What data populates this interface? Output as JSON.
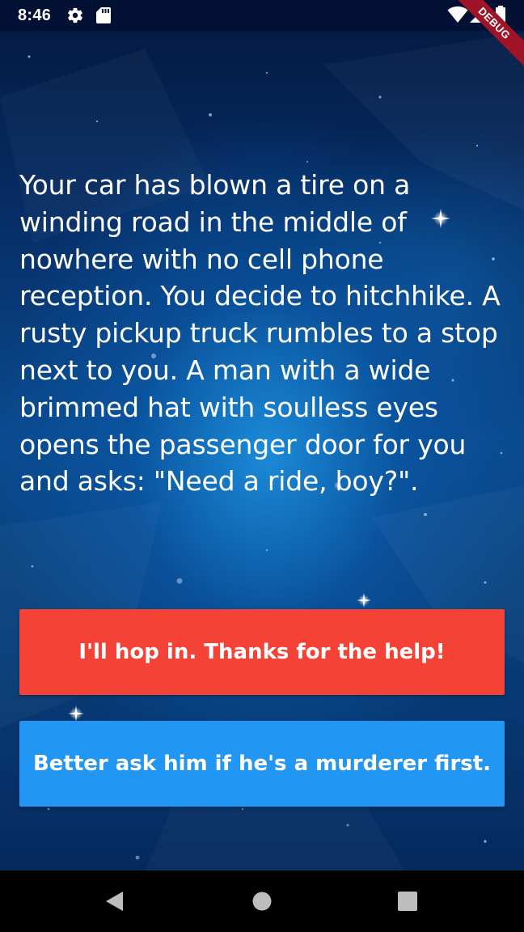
{
  "status_bar": {
    "time": "8:46",
    "icons": [
      "gear-icon",
      "sd-card-icon",
      "wifi-icon",
      "signal-icon",
      "battery-icon"
    ]
  },
  "debug_banner": {
    "label": "DEBUG",
    "color": "#a01428"
  },
  "story": {
    "text": "Your car has blown a tire on a winding road in the middle of nowhere with no cell phone reception. You decide to hitchhike. A rusty pickup truck rumbles to a stop next to you. A man with a wide brimmed hat with soulless eyes opens the passenger door for you and asks: \"Need a ride, boy?\"."
  },
  "choices": [
    {
      "label": "I'll hop in. Thanks for the help!",
      "color": "#f44336"
    },
    {
      "label": "Better ask him if he's a murderer first.",
      "color": "#2196f3"
    }
  ],
  "nav_bar": {
    "buttons": [
      "back-icon",
      "home-icon",
      "recents-icon"
    ]
  }
}
